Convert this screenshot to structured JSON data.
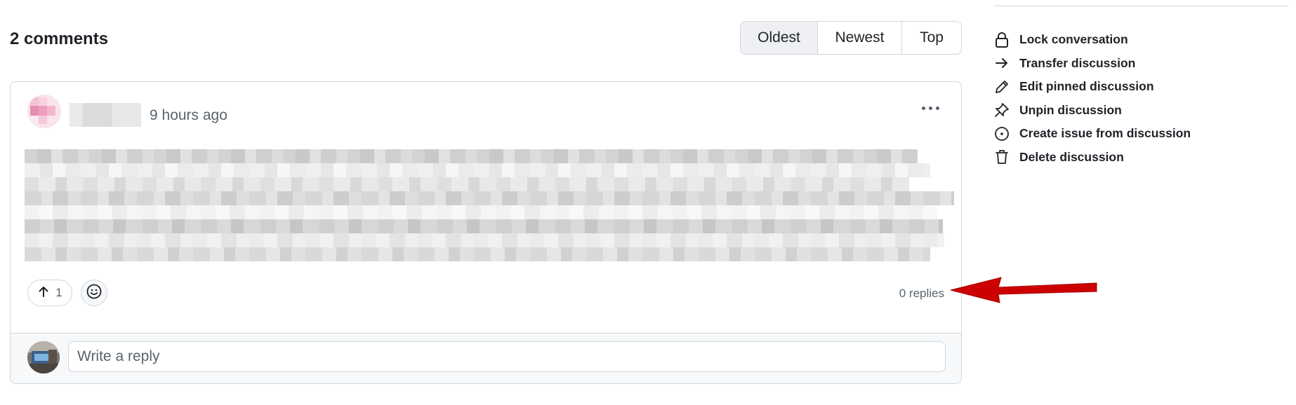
{
  "header": {
    "comments_count_label": "2 comments",
    "sort_options": [
      "Oldest",
      "Newest",
      "Top"
    ],
    "active_sort": "Oldest"
  },
  "comment": {
    "timestamp": "9 hours ago",
    "upvote_count": "1",
    "replies_label": "0 replies"
  },
  "reply": {
    "placeholder": "Write a reply"
  },
  "sidebar": {
    "items": [
      {
        "label": "Lock conversation",
        "icon": "lock-icon"
      },
      {
        "label": "Transfer discussion",
        "icon": "arrow-right-icon"
      },
      {
        "label": "Edit pinned discussion",
        "icon": "pencil-icon"
      },
      {
        "label": "Unpin discussion",
        "icon": "pin-slash-icon"
      },
      {
        "label": "Create issue from discussion",
        "icon": "issue-opened-icon"
      },
      {
        "label": "Delete discussion",
        "icon": "trash-icon"
      }
    ]
  },
  "colors": {
    "text_primary": "#1f2328",
    "text_muted": "#59636e",
    "border": "#d0d7de",
    "active_sort_bg": "#eef0f3",
    "annotation_arrow": "#cc0000"
  }
}
